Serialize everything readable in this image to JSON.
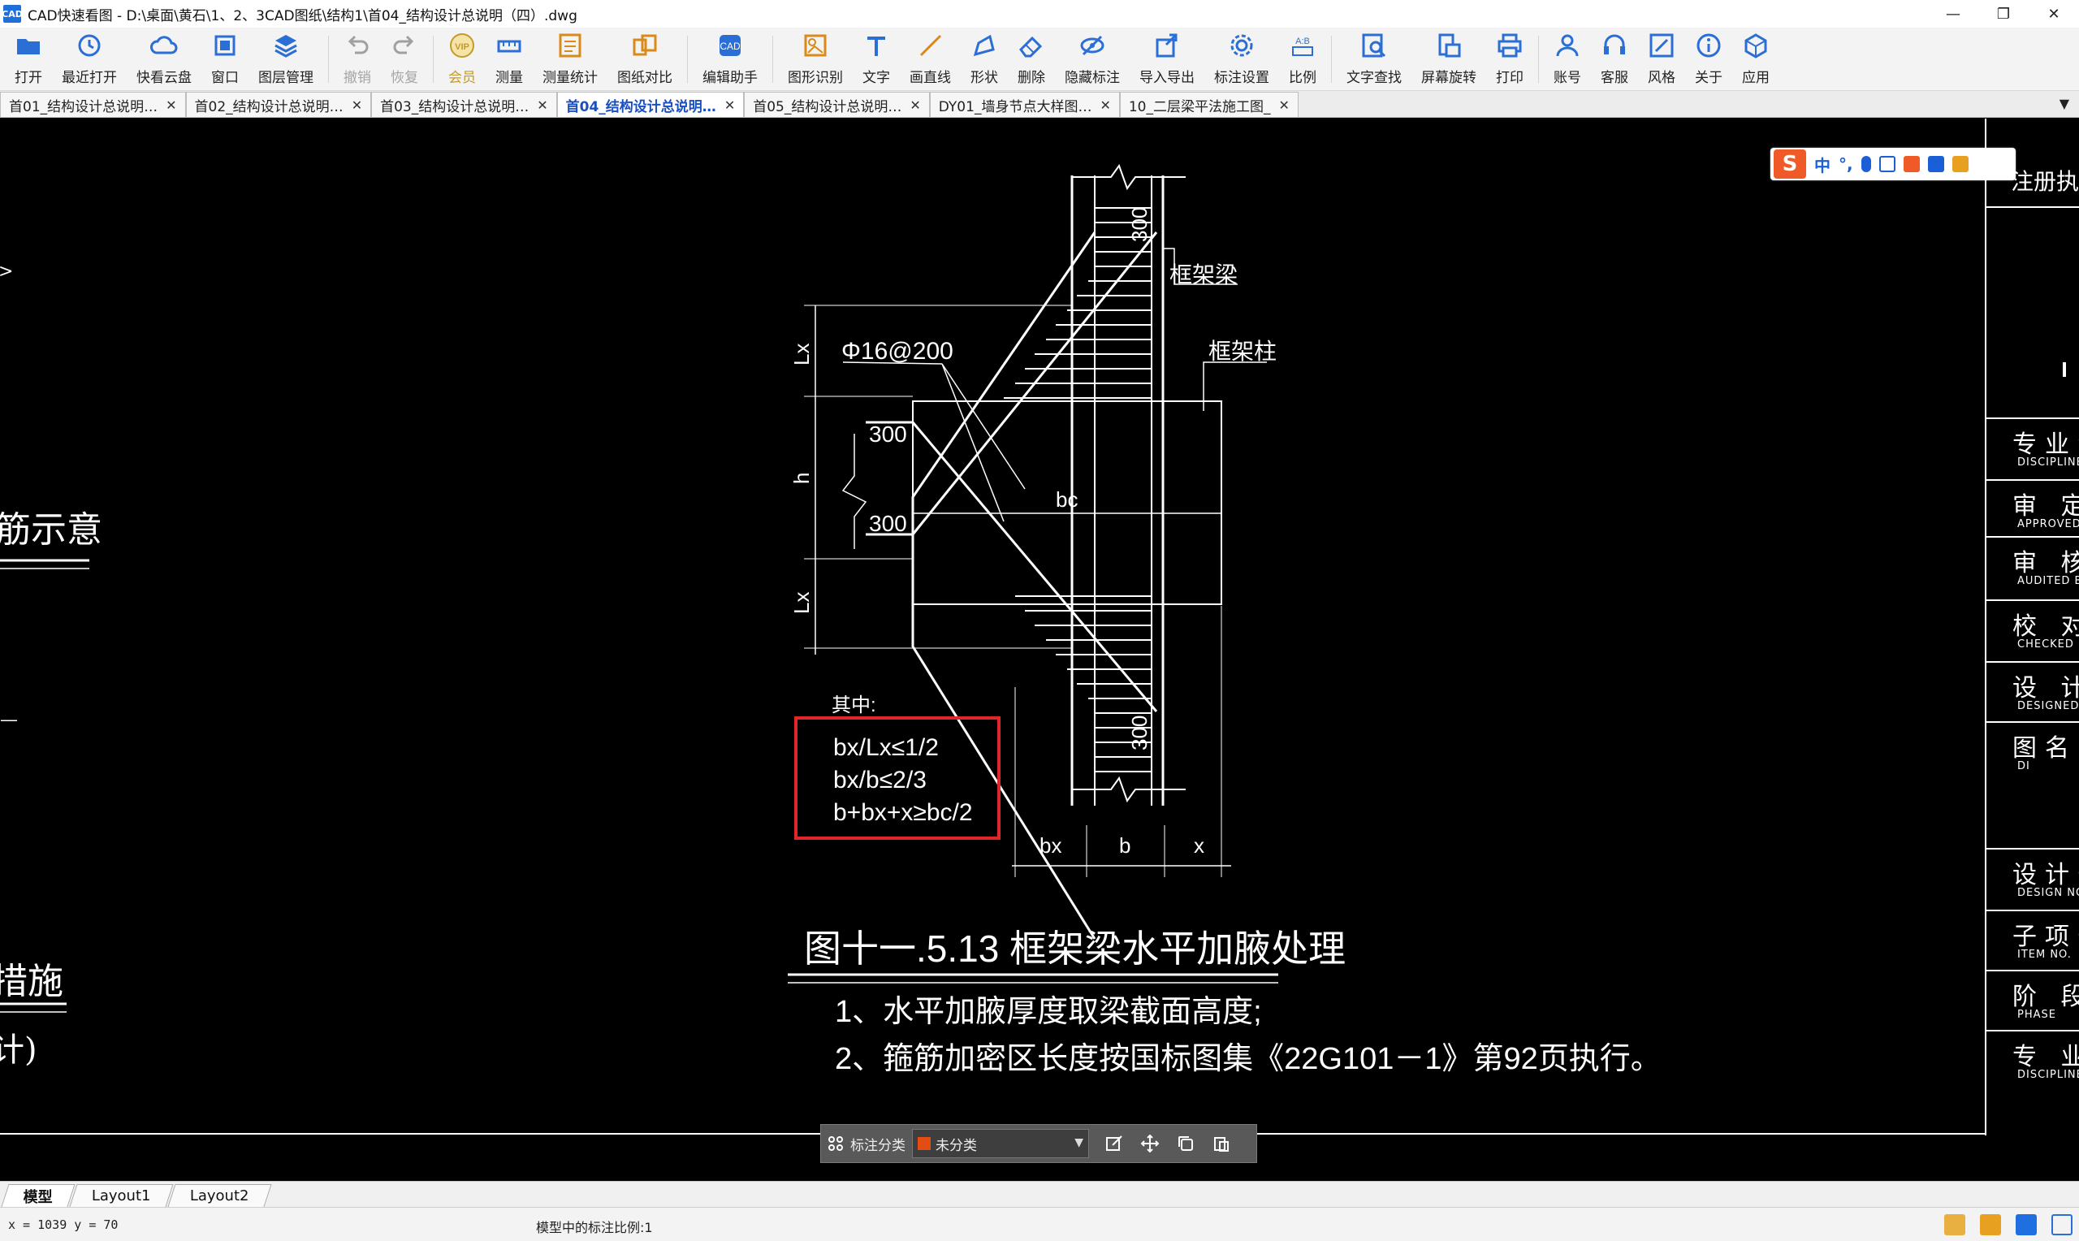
{
  "window": {
    "app_icon_text": "CAD",
    "title": "CAD快速看图 - D:\\桌面\\黄石\\1、2、3CAD图纸\\结构1\\首04_结构设计总说明（四）.dwg",
    "minimize": "—",
    "maximize": "❐",
    "close": "✕"
  },
  "toolbar": {
    "items": [
      {
        "label": "打开",
        "icon": "open-folder-icon",
        "color": "#2b6fd6"
      },
      {
        "label": "最近打开",
        "icon": "recent-icon",
        "color": "#2b6fd6"
      },
      {
        "label": "快看云盘",
        "icon": "cloud-icon",
        "color": "#2b6fd6"
      },
      {
        "label": "窗口",
        "icon": "window-icon",
        "color": "#2b6fd6"
      },
      {
        "label": "图层管理",
        "icon": "layers-icon",
        "color": "#2b6fd6"
      },
      {
        "label": "撤销",
        "icon": "undo-icon",
        "color": "#a0a0a0",
        "disabled": true
      },
      {
        "label": "恢复",
        "icon": "redo-icon",
        "color": "#a0a0a0",
        "disabled": true
      },
      {
        "label": "会员",
        "icon": "vip-icon",
        "color": "#c49a2a",
        "vip": true
      },
      {
        "label": "测量",
        "icon": "measure-icon",
        "color": "#2b6fd6"
      },
      {
        "label": "测量统计",
        "icon": "measure-stats-icon",
        "color": "#d88a1a"
      },
      {
        "label": "图纸对比",
        "icon": "compare-icon",
        "color": "#d88a1a"
      },
      {
        "label": "编辑助手",
        "icon": "edit-assistant-icon",
        "color": "#2b6fd6"
      },
      {
        "label": "图形识别",
        "icon": "shape-recognition-icon",
        "color": "#d88a1a"
      },
      {
        "label": "文字",
        "icon": "text-icon",
        "color": "#2b6fd6"
      },
      {
        "label": "画直线",
        "icon": "line-icon",
        "color": "#d88a1a"
      },
      {
        "label": "形状",
        "icon": "shape-icon",
        "color": "#2b6fd6"
      },
      {
        "label": "删除",
        "icon": "eraser-icon",
        "color": "#2b6fd6"
      },
      {
        "label": "隐藏标注",
        "icon": "hide-annotation-icon",
        "color": "#2b6fd6"
      },
      {
        "label": "导入导出",
        "icon": "import-export-icon",
        "color": "#2b6fd6"
      },
      {
        "label": "标注设置",
        "icon": "annotation-settings-icon",
        "color": "#2b6fd6"
      },
      {
        "label": "比例",
        "icon": "scale-icon",
        "color": "#2b6fd6"
      },
      {
        "label": "文字查找",
        "icon": "text-search-icon",
        "color": "#2b6fd6"
      },
      {
        "label": "屏幕旋转",
        "icon": "rotate-screen-icon",
        "color": "#2b6fd6"
      },
      {
        "label": "打印",
        "icon": "print-icon",
        "color": "#2b6fd6"
      },
      {
        "label": "账号",
        "icon": "account-icon",
        "color": "#2b6fd6"
      },
      {
        "label": "客服",
        "icon": "headset-icon",
        "color": "#2b6fd6"
      },
      {
        "label": "风格",
        "icon": "style-icon",
        "color": "#2b6fd6"
      },
      {
        "label": "关于",
        "icon": "info-icon",
        "color": "#2b6fd6"
      },
      {
        "label": "应用",
        "icon": "apps-icon",
        "color": "#2b6fd6"
      }
    ]
  },
  "tabs": [
    {
      "label": "首01_结构设计总说明…",
      "close": "✕"
    },
    {
      "label": "首02_结构设计总说明…",
      "close": "✕"
    },
    {
      "label": "首03_结构设计总说明…",
      "close": "✕"
    },
    {
      "label": "首04_结构设计总说明…",
      "close": "✕",
      "active": true
    },
    {
      "label": "首05_结构设计总说明…",
      "close": "✕"
    },
    {
      "label": "DY01_墙身节点大样图…",
      "close": "✕"
    },
    {
      "label": "10_二层梁平法施工图_",
      "close": "✕"
    }
  ],
  "tabs_menu": "▼",
  "ime": {
    "logo": "S",
    "mode": "中",
    "punct": "°,"
  },
  "drawing": {
    "label_kuangjialiang": "框架梁",
    "label_kuangjiazhu": "框架柱",
    "rebar": "Φ16@200",
    "dim_300": "300",
    "dim_Lx": "Lx",
    "dim_h": "h",
    "dim_bc": "bc",
    "dim_bx": "bx",
    "dim_b": "b",
    "dim_x": "x",
    "where": "其中:",
    "formulas": [
      "bx/Lx≤1/2",
      "bx/b≤2/3",
      "b+bx+x≥bc/2"
    ],
    "highlight_color": "#e0262b",
    "figure_title": "图十一.5.13  框架梁水平加腋处理",
    "notes": [
      "1、水平加腋厚度取梁截面高度;",
      "2、箍筋加密区长度按国标图集《22G101－1》第92页执行。"
    ]
  },
  "left_fragments": {
    "text1": "筋示意",
    "text2": "措施",
    "text3": "计)",
    "arrow": ">",
    "dash": "—"
  },
  "title_block": {
    "register": "注册执",
    "cells": [
      {
        "cn": "专业负责",
        "en": "DISCIPLINE CH"
      },
      {
        "cn": "审  定",
        "en": "APPROVED B"
      },
      {
        "cn": "审  核",
        "en": "AUDITED BY"
      },
      {
        "cn": "校  对",
        "en": "CHECKED BY"
      },
      {
        "cn": "设  计",
        "en": "DESIGNED B"
      },
      {
        "cn": "图名",
        "en": "DI"
      },
      {
        "cn": "设计号",
        "en": "DESIGN NO."
      },
      {
        "cn": "子项号",
        "en": "ITEM NO."
      },
      {
        "cn": "阶  段",
        "en": "PHASE"
      },
      {
        "cn": "专  业",
        "en": "DISCIPLINE"
      }
    ]
  },
  "annotation_bar": {
    "label": "标注分类",
    "selected": "未分类",
    "swatch": "#e24d12"
  },
  "layout_tabs": [
    "模型",
    "Layout1",
    "Layout2"
  ],
  "status": {
    "coords": "x = 1039  y = 70",
    "scale": "模型中的标注比例:1"
  }
}
